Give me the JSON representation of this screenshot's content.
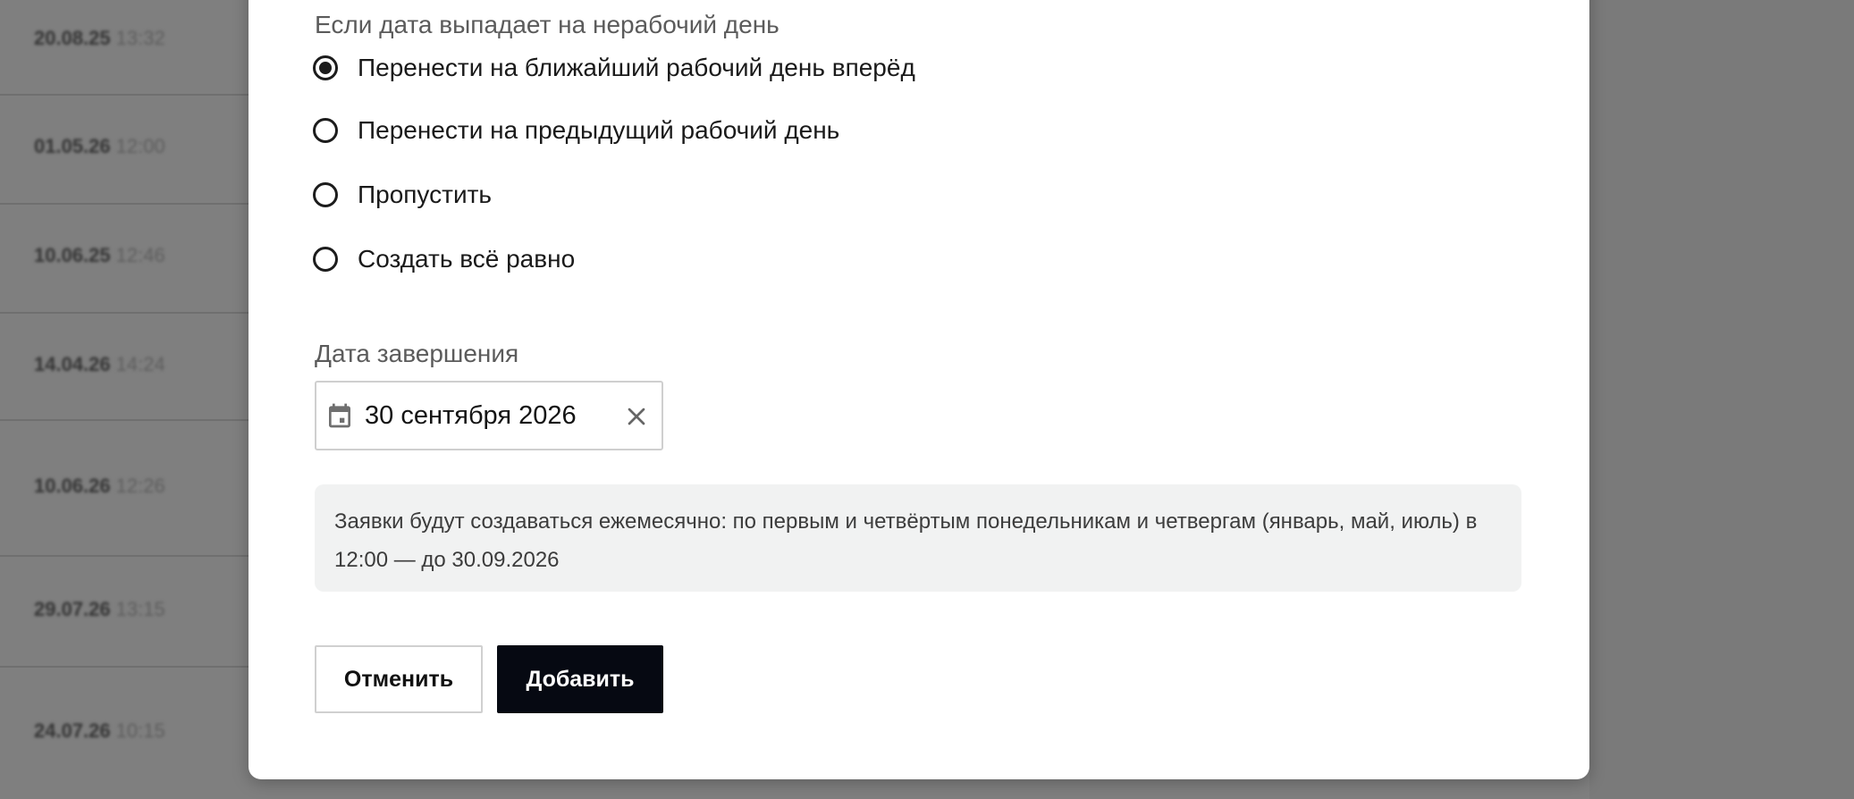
{
  "background": {
    "rows": [
      {
        "date": "20.08.25",
        "time": "13:32"
      },
      {
        "date": "01.05.26",
        "time": "12:00"
      },
      {
        "date": "10.06.25",
        "time": "12:46"
      },
      {
        "date": "14.04.26",
        "time": "14:24"
      },
      {
        "date": "10.06.26",
        "time": "12:26"
      },
      {
        "date": "29.07.26",
        "time": "13:15"
      },
      {
        "date": "24.07.26",
        "time": "10:15"
      }
    ]
  },
  "modal": {
    "non_working_day": {
      "label": "Если дата выпадает на нерабочий день",
      "options": [
        {
          "label": "Перенести на ближайший рабочий день вперёд",
          "selected": true
        },
        {
          "label": "Перенести на предыдущий рабочий день",
          "selected": false
        },
        {
          "label": "Пропустить",
          "selected": false
        },
        {
          "label": "Создать всё равно",
          "selected": false
        }
      ]
    },
    "end_date": {
      "label": "Дата завершения",
      "value": "30 сентября 2026",
      "icon": "calendar-icon",
      "clear_icon": "close-icon"
    },
    "summary": "Заявки будут создаваться ежемесячно: по первым и четвёртым понедельникам и четвергам (январь, май, июль) в 12:00 — до 30.09.2026",
    "buttons": {
      "cancel": "Отменить",
      "add": "Добавить"
    },
    "colors": {
      "primary_button": "#060912",
      "summary_bg": "#f1f2f2"
    }
  }
}
